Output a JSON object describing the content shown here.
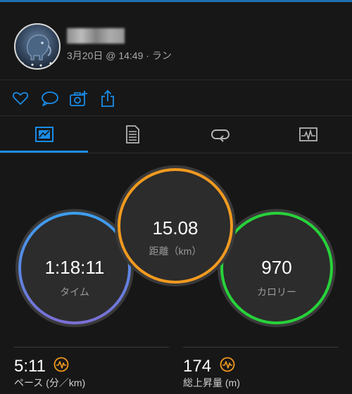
{
  "header": {
    "meta": "3月20日 @ 14:49 · ラン"
  },
  "actions": [
    {
      "icon": "heart-icon"
    },
    {
      "icon": "comment-icon"
    },
    {
      "icon": "add-photo-icon"
    },
    {
      "icon": "share-icon"
    }
  ],
  "tabs": [
    {
      "icon": "overview-icon",
      "selected": true
    },
    {
      "icon": "stats-list-icon",
      "selected": false
    },
    {
      "icon": "laps-icon",
      "selected": false
    },
    {
      "icon": "chart-icon",
      "selected": false
    }
  ],
  "rings": {
    "time": {
      "value": "1:18:11",
      "label": "タイム"
    },
    "distance": {
      "value": "15.08",
      "label": "距離（km）"
    },
    "calories": {
      "value": "970",
      "label": "カロリー"
    }
  },
  "stats": [
    {
      "value": "5:11",
      "label": "ペース (分／km)",
      "icon": "activity-badge-icon"
    },
    {
      "value": "174",
      "label": "総上昇量 (m)",
      "icon": "activity-badge-icon"
    }
  ],
  "colors": {
    "accent": "#1a8ce8",
    "time_ring_start": "#3b9ff0",
    "time_ring_end": "#7b6fd6",
    "distance_ring": "#f29a1f",
    "calories_ring": "#27d23a",
    "badge": "#f29a1f"
  }
}
